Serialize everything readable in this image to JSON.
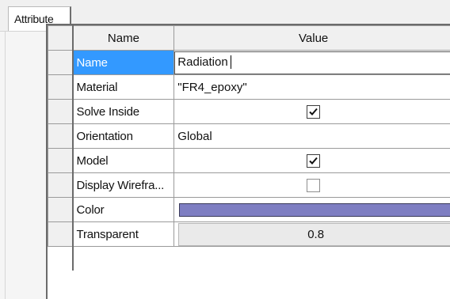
{
  "tab": {
    "label": "Attribute"
  },
  "grid": {
    "columns": {
      "name": "Name",
      "value": "Value"
    },
    "rows": [
      {
        "name": "Name",
        "value": "Radiation",
        "type": "edit",
        "selected": true
      },
      {
        "name": "Material",
        "value": "\"FR4_epoxy\"",
        "type": "text"
      },
      {
        "name": "Solve Inside",
        "checked": true,
        "type": "checkbox"
      },
      {
        "name": "Orientation",
        "value": "Global",
        "type": "text"
      },
      {
        "name": "Model",
        "checked": true,
        "type": "checkbox"
      },
      {
        "name": "Display Wirefra...",
        "checked": false,
        "type": "checkbox"
      },
      {
        "name": "Color",
        "color": "#7e7ec2",
        "type": "color"
      },
      {
        "name": "Transparent",
        "value": "0.8",
        "type": "field"
      }
    ]
  },
  "colors": {
    "selection": "#3399ff",
    "swatch": "#7e7ec2"
  }
}
